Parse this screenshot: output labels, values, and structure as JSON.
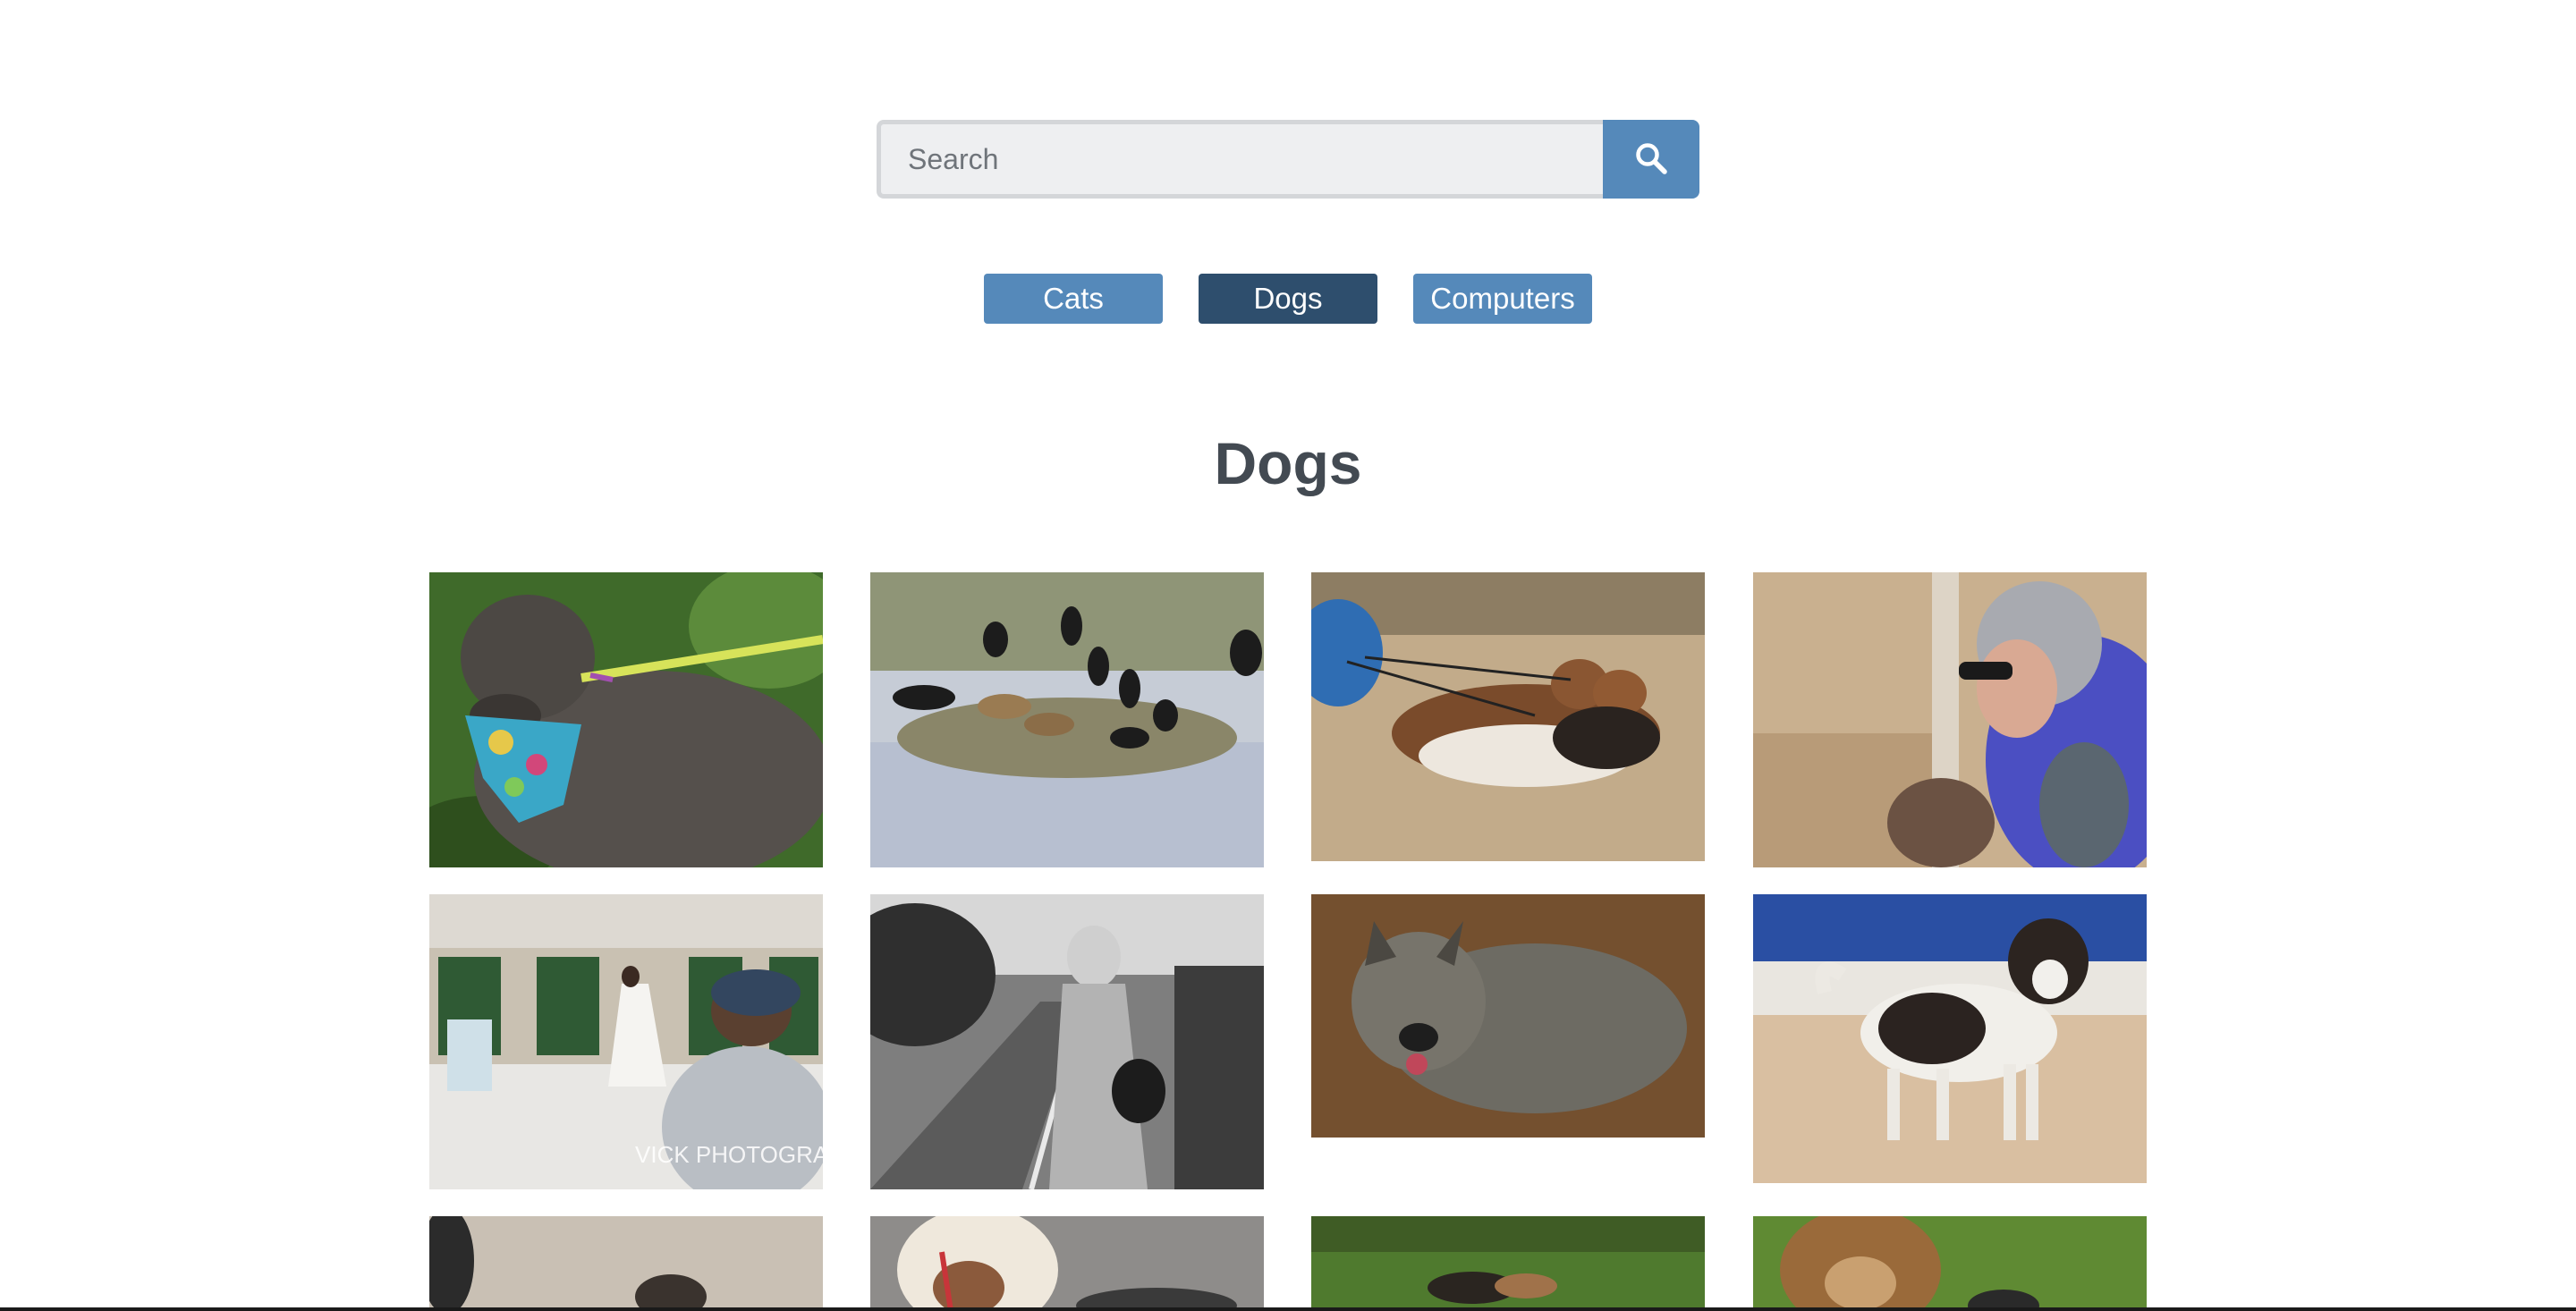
{
  "search": {
    "placeholder": "Search",
    "value": "",
    "button_icon": "search-icon"
  },
  "categories": [
    {
      "label": "Cats",
      "active": false
    },
    {
      "label": "Dogs",
      "active": true
    },
    {
      "label": "Computers",
      "active": false
    }
  ],
  "gallery": {
    "title": "Dogs",
    "images": [
      {
        "name": "grey-dog-bandana-photo"
      },
      {
        "name": "dogs-and-vultures-photo"
      },
      {
        "name": "basset-hounds-leashes-photo"
      },
      {
        "name": "woman-kissing-dog-photo"
      },
      {
        "name": "wedding-dog-photo",
        "watermark": "VICK PHOTOGRA"
      },
      {
        "name": "woman-walking-dog-bw-photo"
      },
      {
        "name": "shaggy-terrier-photo"
      },
      {
        "name": "shih-tzu-poolside-photo"
      },
      {
        "name": "dog-on-sand-photo"
      },
      {
        "name": "curly-dog-red-collar-photo"
      },
      {
        "name": "dog-running-grass-photo"
      },
      {
        "name": "brown-dog-grass-photo"
      }
    ]
  },
  "colors": {
    "button": "#5589ba",
    "button_active": "#2e4e6d",
    "heading": "#434a52",
    "input_bg": "#eeeff1"
  }
}
